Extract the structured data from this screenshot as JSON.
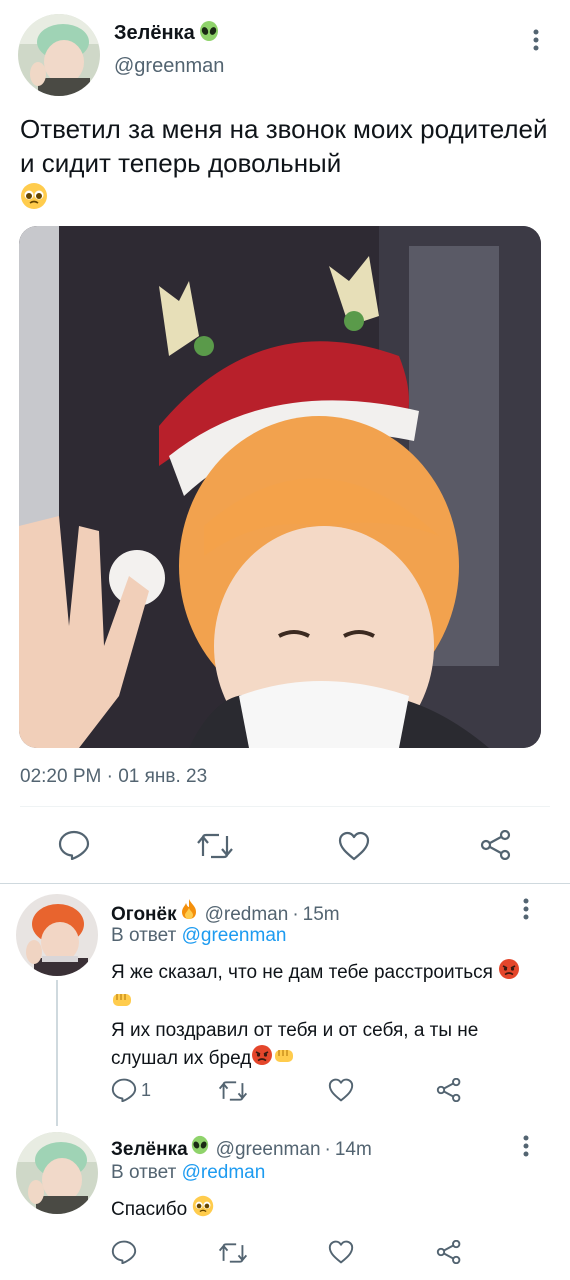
{
  "main_tweet": {
    "author_name": "Зелёнка",
    "author_emoji": "alien-icon",
    "handle": "@greenman",
    "text": "Ответил за меня на звонок моих родителей и сидит теперь довольный",
    "text_emoji": "pleading-face-icon",
    "timestamp": "02:20 PM · 01 янв. 23",
    "media_alt": "photo",
    "actions": {
      "reply": "reply-icon",
      "retweet": "retweet-icon",
      "like": "heart-icon",
      "share": "share-icon"
    }
  },
  "replies": [
    {
      "author_name": "Огонёк",
      "author_emoji": "fire-icon",
      "handle": "@redman",
      "time": "15m",
      "reply_to_prefix": "В ответ",
      "reply_to_handle": "@greenman",
      "text_line1": "Я же сказал, что не дам тебе расстроиться",
      "text_line2": "Я их поздравил от тебя и от себя, а ты не слушал их бред",
      "reply_count": "1"
    },
    {
      "author_name": "Зелёнка",
      "author_emoji": "alien-icon",
      "handle": "@greenman",
      "time": "14m",
      "reply_to_prefix": "В ответ",
      "reply_to_handle": "@redman",
      "text": "Спасибо"
    }
  ],
  "sep_dot": "·",
  "colors": {
    "text": "#0f1419",
    "secondary": "#536471",
    "link": "#1d9bf0",
    "divider": "#eff3f4"
  }
}
